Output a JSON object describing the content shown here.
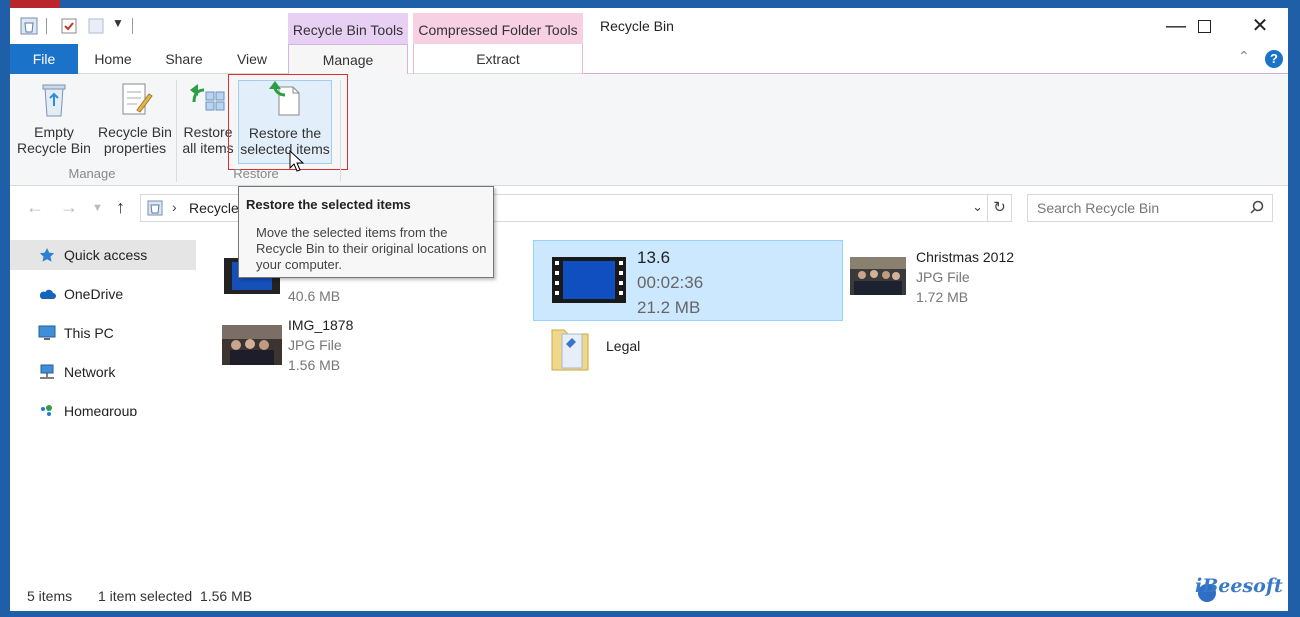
{
  "window": {
    "title": "Recycle Bin",
    "context_tabs": {
      "recycle_bin_tools": "Recycle Bin Tools",
      "compressed_folder_tools": "Compressed Folder Tools"
    }
  },
  "ribbon_tabs": {
    "file": "File",
    "home": "Home",
    "share": "Share",
    "view": "View",
    "manage": "Manage",
    "extract": "Extract"
  },
  "ribbon": {
    "empty_recycle_bin": [
      "Empty",
      "Recycle Bin"
    ],
    "recycle_bin_properties": [
      "Recycle Bin",
      "properties"
    ],
    "restore_all_items": [
      "Restore",
      "all items"
    ],
    "restore_selected_items": [
      "Restore the",
      "selected items"
    ],
    "group_manage": "Manage",
    "group_restore": "Restore"
  },
  "tooltip": {
    "title": "Restore the selected items",
    "body": "Move the selected items from the Recycle Bin to their original locations on your computer."
  },
  "address": {
    "crumb": "Recycle",
    "search_placeholder": "Search Recycle Bin"
  },
  "nav_pane": {
    "quick_access": "Quick access",
    "onedrive": "OneDrive",
    "this_pc": "This PC",
    "network": "Network",
    "homegroup": "Homegroup"
  },
  "files": {
    "video_partial": {
      "size": "40.6 MB"
    },
    "img_1878": {
      "name": "IMG_1878",
      "type": "JPG File",
      "size": "1.56 MB"
    },
    "video_136": {
      "name": "13.6",
      "duration": "00:02:36",
      "size": "21.2 MB"
    },
    "legal": {
      "name": "Legal"
    },
    "christmas": {
      "name": "Christmas 2012",
      "type": "JPG File",
      "size": "1.72 MB"
    }
  },
  "status": {
    "count": "5 items",
    "selection": "1 item selected  1.56 MB"
  },
  "watermark": "iBeesoft",
  "colors": {
    "accent": "#1a73c8",
    "selection_bg": "#cce8ff",
    "highlight_border": "#d9302c"
  }
}
